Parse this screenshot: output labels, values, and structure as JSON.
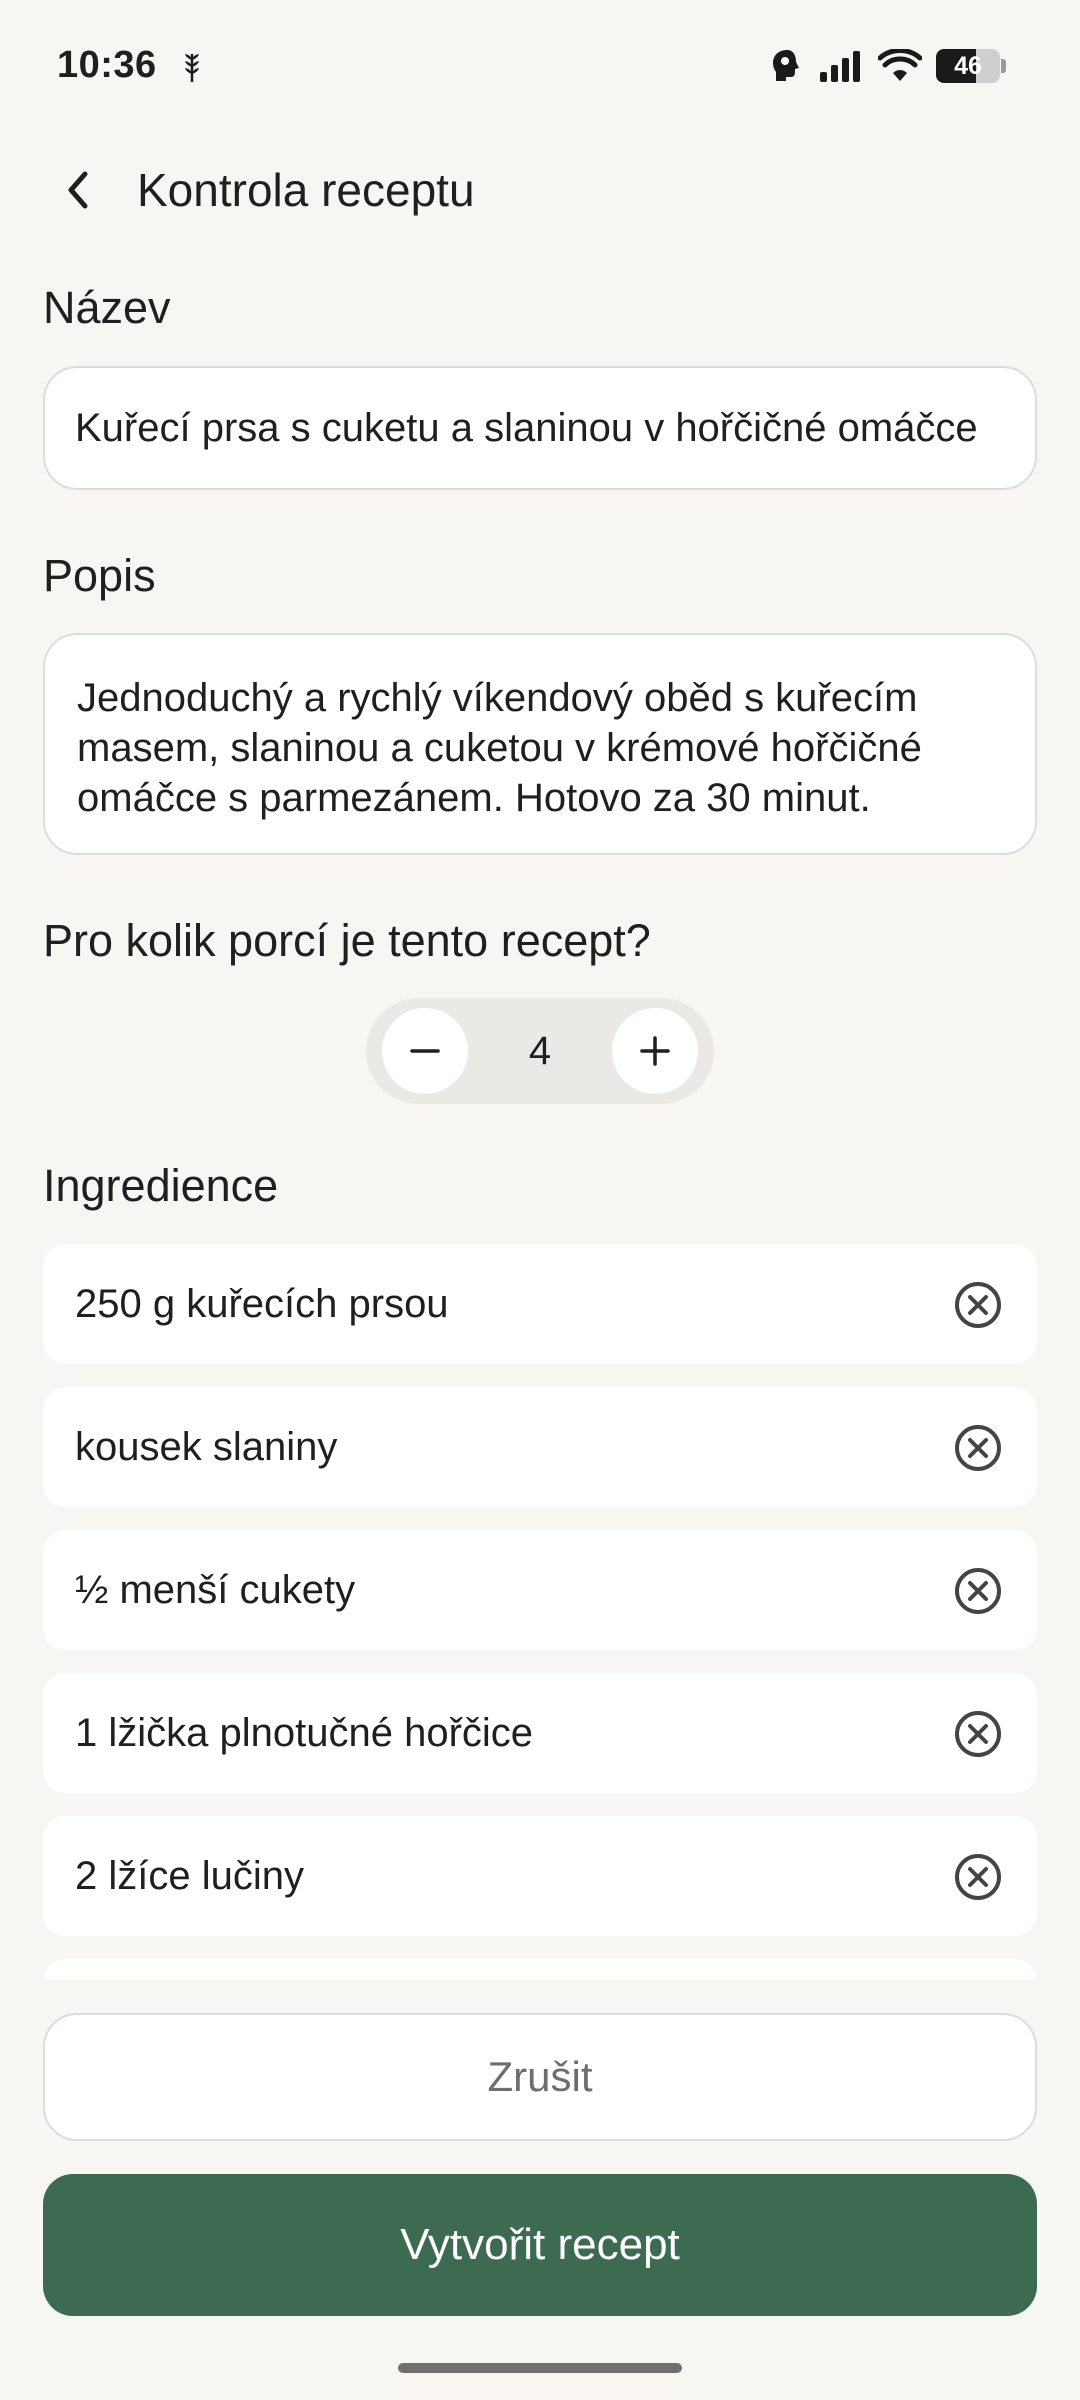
{
  "status_bar": {
    "time": "10:36",
    "battery_level": "46",
    "battery_fill_percent": 62,
    "icons": [
      "wheat-icon",
      "assistant-head-icon",
      "signal-icon",
      "wifi-icon",
      "battery-icon"
    ]
  },
  "header": {
    "title": "Kontrola receptu",
    "back_icon": "chevron-left-icon"
  },
  "name": {
    "label": "Název",
    "value": "Kuřecí prsa s cuketu a slaninou v hořčičné omáčce"
  },
  "description": {
    "label": "Popis",
    "value": "Jednoduchý a rychlý víkendový oběd s kuřecím masem, slaninou a cuketou v krémové hořčičné omáčce s parmezánem. Hotovo za 30 minut."
  },
  "servings": {
    "label": "Pro kolik porcí je tento recept?",
    "value": "4"
  },
  "ingredients": {
    "label": "Ingredience",
    "items": [
      {
        "text": "250 g kuřecích prsou"
      },
      {
        "text": "kousek slaniny"
      },
      {
        "text": "½ menší cukety"
      },
      {
        "text": "1 lžička plnotučné hořčice"
      },
      {
        "text": "2 lžíce lučiny"
      },
      {
        "text": ""
      }
    ]
  },
  "actions": {
    "cancel_label": "Zrušit",
    "create_label": "Vytvořit recept"
  },
  "colors": {
    "primary": "#3d6b51",
    "background": "#f7f6f3"
  }
}
